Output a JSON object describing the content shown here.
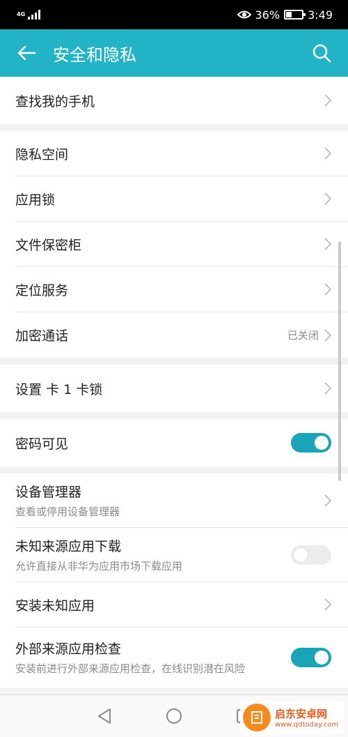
{
  "status_bar": {
    "network": "4G",
    "battery_percent": "36%",
    "battery_level": 0.36,
    "time": "3:49"
  },
  "app_bar": {
    "title": "安全和隐私",
    "back_icon": "arrow-left-icon",
    "search_icon": "search-icon",
    "background_color": "#22b3c6"
  },
  "groups": [
    {
      "items": [
        {
          "label": "查找我的手机",
          "type": "link"
        }
      ]
    },
    {
      "items": [
        {
          "label": "隐私空间",
          "type": "link"
        },
        {
          "label": "应用锁",
          "type": "link"
        },
        {
          "label": "文件保密柜",
          "type": "link"
        },
        {
          "label": "定位服务",
          "type": "link"
        },
        {
          "label": "加密通话",
          "type": "link",
          "value": "已关闭"
        }
      ]
    },
    {
      "items": [
        {
          "label": "设置 卡 1 卡锁",
          "type": "link"
        }
      ]
    },
    {
      "items": [
        {
          "label": "密码可见",
          "type": "toggle",
          "checked": true
        }
      ]
    },
    {
      "items": [
        {
          "label": "设备管理器",
          "sub": "查看或停用设备管理器",
          "type": "link"
        },
        {
          "label": "未知来源应用下载",
          "sub": "允许直接从非华为应用市场下载应用",
          "type": "toggle",
          "checked": false
        },
        {
          "label": "安装未知应用",
          "type": "link"
        },
        {
          "label": "外部来源应用检查",
          "sub": "安装前进行外部来源应用检查，在线识别潜在风险",
          "type": "toggle",
          "checked": true
        }
      ]
    }
  ],
  "nav_bar": {
    "back_icon": "triangle-back-icon",
    "home_icon": "circle-home-icon",
    "recents_icon": "square-recents-icon"
  },
  "watermark": {
    "name": "启东安卓网",
    "url": "www.qdtoday.com"
  },
  "colors": {
    "accent": "#1aa4b8",
    "toggle_off": "#ececec"
  }
}
